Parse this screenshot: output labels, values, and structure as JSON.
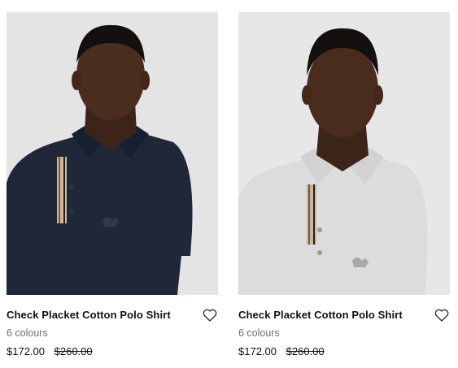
{
  "products": [
    {
      "title": "Check Placket Cotton Polo Shirt",
      "colours": "6 colours",
      "price": "$172.00",
      "original_price": "$260.00",
      "shirt_color": "#1f2739",
      "wishlist_icon": "heart-outline-icon"
    },
    {
      "title": "Check Placket Cotton Polo Shirt",
      "colours": "6 colours",
      "price": "$172.00",
      "original_price": "$260.00",
      "shirt_color": "#e4e4e4",
      "wishlist_icon": "heart-outline-icon"
    }
  ]
}
